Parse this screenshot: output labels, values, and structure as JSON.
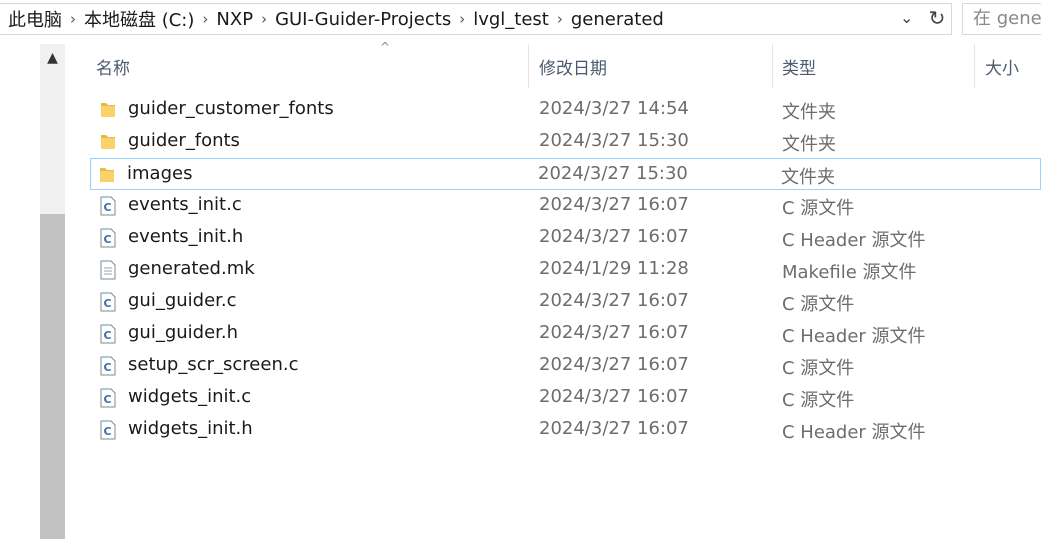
{
  "breadcrumb": {
    "items": [
      "此电脑",
      "本地磁盘 (C:)",
      "NXP",
      "GUI-Guider-Projects",
      "lvgl_test",
      "generated"
    ]
  },
  "search": {
    "placeholder": "在 gener"
  },
  "columns": {
    "name": "名称",
    "date": "修改日期",
    "type": "类型",
    "size": "大小"
  },
  "files": [
    {
      "name": "guider_customer_fonts",
      "date": "2024/3/27 14:54",
      "type": "文件夹",
      "icon": "folder-icon"
    },
    {
      "name": "guider_fonts",
      "date": "2024/3/27 15:30",
      "type": "文件夹",
      "icon": "folder-icon"
    },
    {
      "name": "images",
      "date": "2024/3/27 15:30",
      "type": "文件夹",
      "icon": "folder-icon",
      "selected": true
    },
    {
      "name": "events_init.c",
      "date": "2024/3/27 16:07",
      "type": "C 源文件",
      "icon": "c-file-icon"
    },
    {
      "name": "events_init.h",
      "date": "2024/3/27 16:07",
      "type": "C Header 源文件",
      "icon": "c-file-icon"
    },
    {
      "name": "generated.mk",
      "date": "2024/1/29 11:28",
      "type": "Makefile 源文件",
      "icon": "text-file-icon"
    },
    {
      "name": "gui_guider.c",
      "date": "2024/3/27 16:07",
      "type": "C 源文件",
      "icon": "c-file-icon"
    },
    {
      "name": "gui_guider.h",
      "date": "2024/3/27 16:07",
      "type": "C Header 源文件",
      "icon": "c-file-icon"
    },
    {
      "name": "setup_scr_screen.c",
      "date": "2024/3/27 16:07",
      "type": "C 源文件",
      "icon": "c-file-icon"
    },
    {
      "name": "widgets_init.c",
      "date": "2024/3/27 16:07",
      "type": "C 源文件",
      "icon": "c-file-icon"
    },
    {
      "name": "widgets_init.h",
      "date": "2024/3/27 16:07",
      "type": "C Header 源文件",
      "icon": "c-file-icon"
    }
  ]
}
